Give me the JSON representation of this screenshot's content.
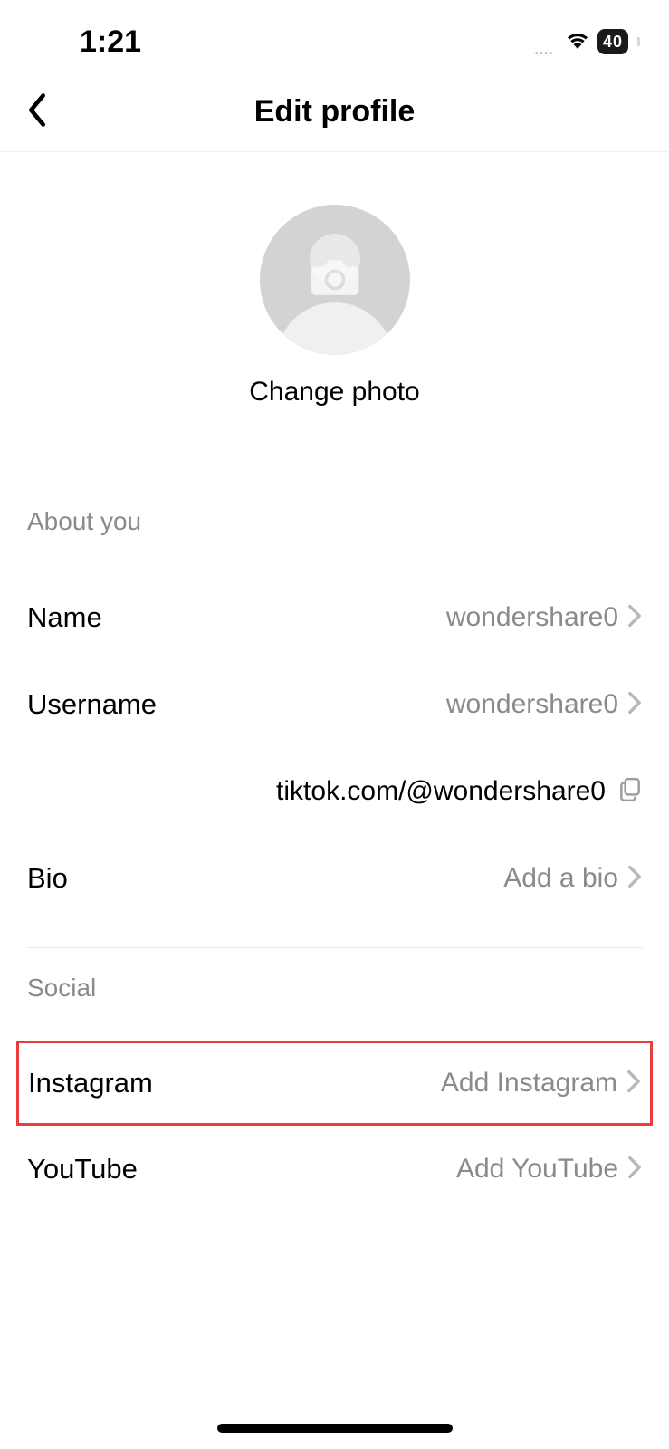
{
  "status": {
    "time": "1:21",
    "battery": "40"
  },
  "header": {
    "title": "Edit profile"
  },
  "profile": {
    "change_photo_label": "Change photo"
  },
  "sections": {
    "about": {
      "title": "About you",
      "name_label": "Name",
      "name_value": "wondershare0",
      "username_label": "Username",
      "username_value": "wondershare0",
      "profile_url": "tiktok.com/@wondershare0",
      "bio_label": "Bio",
      "bio_value": "Add a bio"
    },
    "social": {
      "title": "Social",
      "instagram_label": "Instagram",
      "instagram_value": "Add Instagram",
      "youtube_label": "YouTube",
      "youtube_value": "Add YouTube"
    }
  }
}
